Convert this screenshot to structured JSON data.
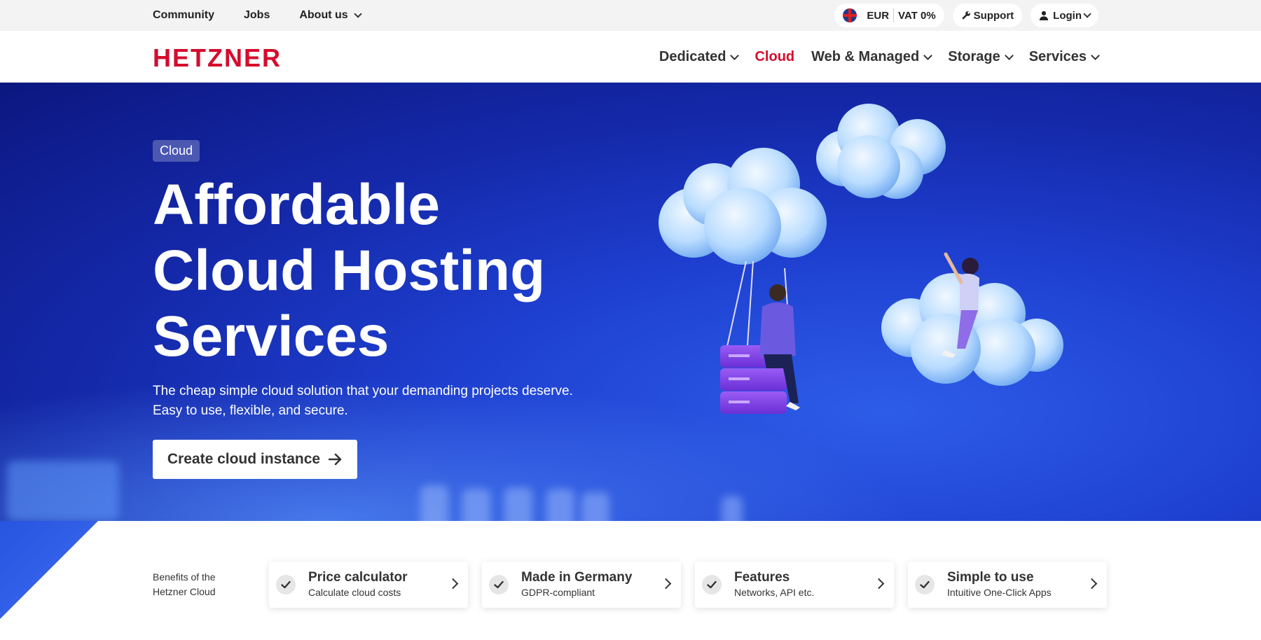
{
  "topbar": {
    "links": [
      {
        "label": "Community"
      },
      {
        "label": "Jobs"
      },
      {
        "label": "About us"
      }
    ],
    "currency": "EUR",
    "vat": "VAT 0%",
    "support": "Support",
    "login": "Login"
  },
  "header": {
    "logo": "HETZNER",
    "nav": [
      {
        "label": "Dedicated"
      },
      {
        "label": "Cloud"
      },
      {
        "label": "Web & Managed"
      },
      {
        "label": "Storage"
      },
      {
        "label": "Services"
      }
    ]
  },
  "hero": {
    "badge": "Cloud",
    "title_line1": "Affordable",
    "title_line2": "Cloud Hosting",
    "title_line3": "Services",
    "subtitle_line1": "The cheap simple cloud solution that your demanding projects deserve.",
    "subtitle_line2": "Easy to use, flexible, and secure.",
    "cta": "Create cloud instance"
  },
  "benefits": {
    "label_line1": "Benefits of the",
    "label_line2": "Hetzner Cloud",
    "cards": [
      {
        "title": "Price calculator",
        "subtitle": "Calculate cloud costs"
      },
      {
        "title": "Made in Germany",
        "subtitle": "GDPR-compliant"
      },
      {
        "title": "Features",
        "subtitle": "Networks, API etc."
      },
      {
        "title": "Simple to use",
        "subtitle": "Intuitive One-Click Apps"
      }
    ]
  },
  "colors": {
    "brand_red": "#d50c2d",
    "hero_blue": "#1e3fd0"
  },
  "icons": [
    "uk-flag-icon",
    "wrench-icon",
    "user-icon",
    "chevron-down-icon",
    "arrow-right-icon",
    "check-icon",
    "chevron-right-icon"
  ]
}
